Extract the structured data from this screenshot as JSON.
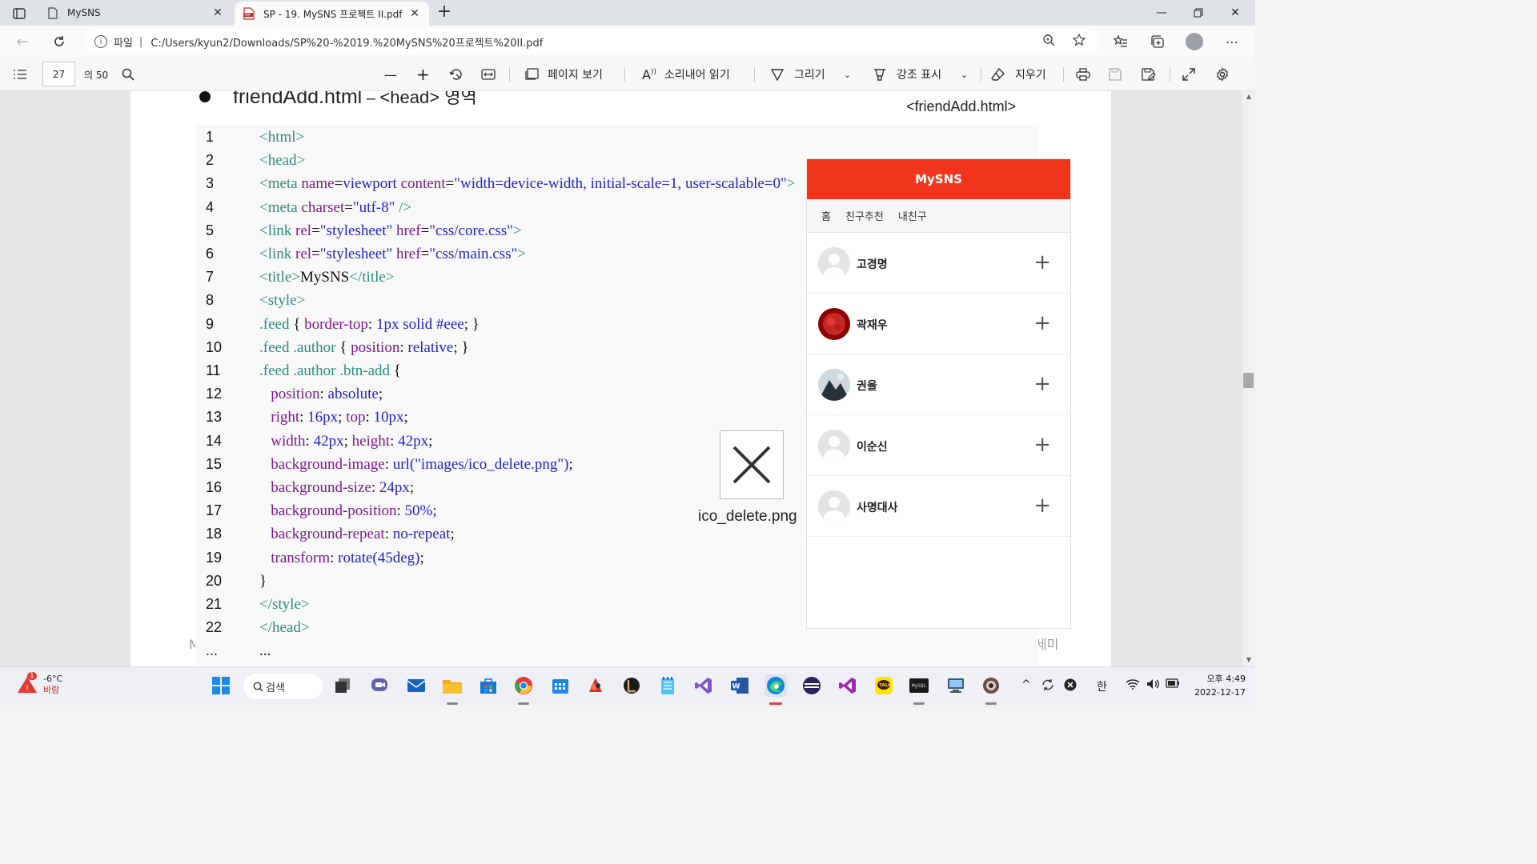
{
  "tabs": [
    {
      "title": "MySNS",
      "active": false
    },
    {
      "title": "SP - 19. MySNS 프로젝트 II.pdf",
      "active": true
    }
  ],
  "address": {
    "scheme_label": "파일",
    "separator": "|",
    "url": "C:/Users/kyun2/Downloads/SP%20-%2019.%20MySNS%20프로젝트%20II.pdf"
  },
  "pdf_toolbar": {
    "page_number": "27",
    "page_total": "의 50",
    "zoom_out": "—",
    "zoom_in": "+",
    "page_view": "페이지 보기",
    "read_aloud": "소리내어 읽기",
    "draw": "그리기",
    "highlight": "강조 표시",
    "erase": "지우기"
  },
  "slide": {
    "heading_main": "friendAdd.html",
    "heading_dash": " – ",
    "heading_sub": "<head> 영역",
    "file_label": "<friendAdd.html>",
    "icon_caption": "ico_delete.png",
    "footer_left": "M",
    "footer_right": "세미"
  },
  "code_lines": [
    {
      "n": "1",
      "html": "<span class=\"t\">&lt;html&gt;</span>"
    },
    {
      "n": "2",
      "html": "<span class=\"t\">&lt;head&gt;</span>"
    },
    {
      "n": "3",
      "html": "<span class=\"t\">&lt;meta</span> <span class=\"a\">name</span><span class=\"p\">=</span><span class=\"s\">viewport</span> <span class=\"a\">content</span><span class=\"p\">=</span><span class=\"s\">\"width=device-width, initial-scale=1, user-scalable=0\"</span><span class=\"t\">&gt;</span>"
    },
    {
      "n": "4",
      "html": "<span class=\"t\">&lt;meta</span> <span class=\"a\">charset</span><span class=\"p\">=</span><span class=\"s\">\"utf-8\"</span> <span class=\"t\">/&gt;</span>"
    },
    {
      "n": "5",
      "html": "<span class=\"t\">&lt;link</span> <span class=\"a\">rel</span><span class=\"p\">=</span><span class=\"s\">\"stylesheet\"</span> <span class=\"a\">href</span><span class=\"p\">=</span><span class=\"s\">\"css/core.css\"</span><span class=\"t\">&gt;</span>"
    },
    {
      "n": "6",
      "html": "<span class=\"t\">&lt;link</span> <span class=\"a\">rel</span><span class=\"p\">=</span><span class=\"s\">\"stylesheet\"</span> <span class=\"a\">href</span><span class=\"p\">=</span><span class=\"s\">\"css/main.css\"</span><span class=\"t\">&gt;</span>"
    },
    {
      "n": "7",
      "html": "<span class=\"t\">&lt;title&gt;</span><span class=\"p\">MySNS</span><span class=\"t\">&lt;/title&gt;</span>"
    },
    {
      "n": "8",
      "html": "<span class=\"t\">&lt;style&gt;</span>"
    },
    {
      "n": "9",
      "html": "<span class=\"t\">.feed</span> <span class=\"p\">{</span> <span class=\"k\">border-top</span><span class=\"p\">:</span> <span class=\"v\">1px solid #eee</span><span class=\"p\">; }</span>"
    },
    {
      "n": "10",
      "html": "<span class=\"t\">.feed .author</span> <span class=\"p\">{</span> <span class=\"k\">position</span><span class=\"p\">:</span> <span class=\"v\">relative</span><span class=\"p\">; }</span>"
    },
    {
      "n": "11",
      "html": "<span class=\"t\">.feed .author .btn-add</span> <span class=\"p\">{</span>"
    },
    {
      "n": "12",
      "html": "   <span class=\"k\">position</span><span class=\"p\">:</span> <span class=\"v\">absolute</span><span class=\"p\">;</span>"
    },
    {
      "n": "13",
      "html": "   <span class=\"k\">right</span><span class=\"p\">:</span> <span class=\"v\">16px</span><span class=\"p\">;</span> <span class=\"k\">top</span><span class=\"p\">:</span> <span class=\"v\">10px</span><span class=\"p\">;</span>"
    },
    {
      "n": "14",
      "html": "   <span class=\"k\">width</span><span class=\"p\">:</span> <span class=\"v\">42px</span><span class=\"p\">;</span> <span class=\"k\">height</span><span class=\"p\">:</span> <span class=\"v\">42px</span><span class=\"p\">;</span>"
    },
    {
      "n": "15",
      "html": "   <span class=\"k\">background-image</span><span class=\"p\">:</span> <span class=\"v\">url(\"images/ico_delete.png\")</span><span class=\"p\">;</span>"
    },
    {
      "n": "16",
      "html": "   <span class=\"k\">background-size</span><span class=\"p\">:</span> <span class=\"v\">24px</span><span class=\"p\">;</span>"
    },
    {
      "n": "17",
      "html": "   <span class=\"k\">background-position</span><span class=\"p\">:</span> <span class=\"v\">50%</span><span class=\"p\">;</span>"
    },
    {
      "n": "18",
      "html": "   <span class=\"k\">background-repeat</span><span class=\"p\">:</span> <span class=\"v\">no-repeat</span><span class=\"p\">;</span>"
    },
    {
      "n": "19",
      "html": "   <span class=\"k\">transform</span><span class=\"p\">:</span> <span class=\"v\">rotate(45deg)</span><span class=\"p\">;</span>"
    },
    {
      "n": "20",
      "html": "<span class=\"p\">}</span>"
    },
    {
      "n": "21",
      "html": "<span class=\"t\">&lt;/style&gt;</span>"
    },
    {
      "n": "22",
      "html": "<span class=\"t\">&lt;/head&gt;</span>"
    },
    {
      "n": "...",
      "html": "<span class=\"p\">...</span>"
    }
  ],
  "phone": {
    "title": "MySNS",
    "nav": [
      "홈",
      "친구추천",
      "내친구"
    ],
    "friends": [
      {
        "name": "고경명",
        "avatar": "default"
      },
      {
        "name": "곽재우",
        "avatar": "red"
      },
      {
        "name": "권율",
        "avatar": "photo"
      },
      {
        "name": "이순신",
        "avatar": "default"
      },
      {
        "name": "사명대사",
        "avatar": "default"
      }
    ],
    "add_symbol": "+",
    "header_color": "#f2361d"
  },
  "taskbar": {
    "weather_temp": "-6°C",
    "weather_desc": "바람",
    "weather_badge": "1",
    "search_label": "검색",
    "ime": "한",
    "time": "오후 4:49",
    "date": "2022-12-17"
  },
  "colors": {
    "accent": "#f2361d",
    "code_tag": "#2e8b7a",
    "code_attr": "#7a1a8a",
    "code_value": "#2222c8"
  }
}
